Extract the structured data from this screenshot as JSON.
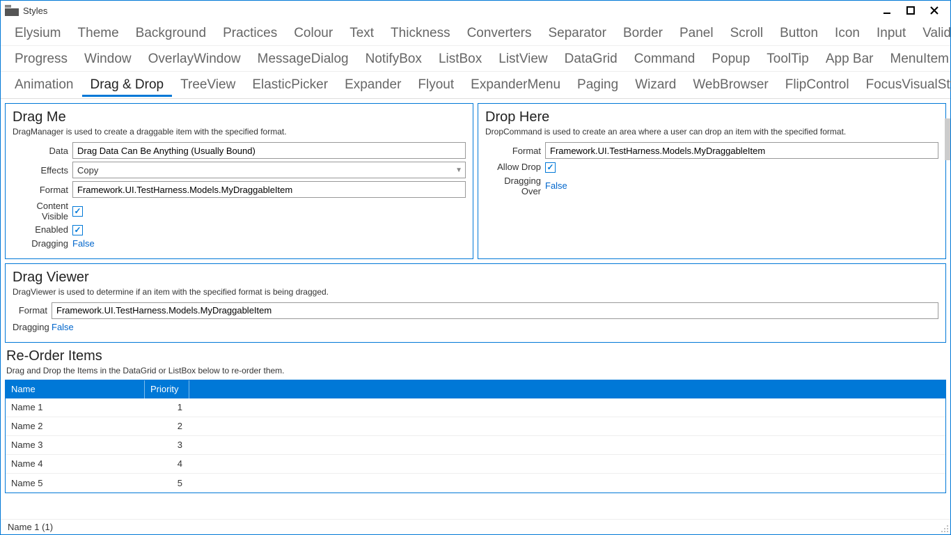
{
  "window": {
    "title": "Styles"
  },
  "tabs": {
    "row1": [
      "Elysium",
      "Theme",
      "Background",
      "Practices",
      "Colour",
      "Text",
      "Thickness",
      "Converters",
      "Separator",
      "Border",
      "Panel",
      "Scroll",
      "Button",
      "Icon",
      "Input",
      "Validation"
    ],
    "row2": [
      "Progress",
      "Window",
      "OverlayWindow",
      "MessageDialog",
      "NotifyBox",
      "ListBox",
      "ListView",
      "DataGrid",
      "Command",
      "Popup",
      "ToolTip",
      "App Bar",
      "MenuItem"
    ],
    "row3": [
      "Animation",
      "Drag & Drop",
      "TreeView",
      "ElasticPicker",
      "Expander",
      "Flyout",
      "ExpanderMenu",
      "Paging",
      "Wizard",
      "WebBrowser",
      "FlipControl",
      "FocusVisualStyle"
    ],
    "active": "Drag & Drop"
  },
  "dragMe": {
    "title": "Drag Me",
    "desc": "DragManager is used to create a draggable item with the specified format.",
    "labels": {
      "data": "Data",
      "effects": "Effects",
      "format": "Format",
      "contentVisible": "Content Visible",
      "enabled": "Enabled",
      "dragging": "Dragging"
    },
    "data": "Drag Data Can Be Anything (Usually Bound)",
    "effects": "Copy",
    "format": "Framework.UI.TestHarness.Models.MyDraggableItem",
    "contentVisible": true,
    "enabled": true,
    "dragging": "False"
  },
  "dropHere": {
    "title": "Drop Here",
    "desc": "DropCommand is used to create an area where a user can drop an item with the specified format.",
    "labels": {
      "format": "Format",
      "allowDrop": "Allow Drop",
      "draggingOver": "Dragging Over"
    },
    "format": "Framework.UI.TestHarness.Models.MyDraggableItem",
    "allowDrop": true,
    "draggingOver": "False"
  },
  "dragViewer": {
    "title": "Drag Viewer",
    "desc": "DragViewer is used to determine if an item with the specified format is being dragged.",
    "labels": {
      "format": "Format",
      "dragging": "Dragging"
    },
    "format": "Framework.UI.TestHarness.Models.MyDraggableItem",
    "dragging": "False"
  },
  "reorder": {
    "title": "Re-Order Items",
    "desc": "Drag and Drop the Items in the DataGrid or ListBox below to re-order them.",
    "columns": {
      "name": "Name",
      "priority": "Priority"
    },
    "rows": [
      {
        "name": "Name 1",
        "priority": "1"
      },
      {
        "name": "Name 2",
        "priority": "2"
      },
      {
        "name": "Name 3",
        "priority": "3"
      },
      {
        "name": "Name 4",
        "priority": "4"
      },
      {
        "name": "Name 5",
        "priority": "5"
      }
    ]
  },
  "status": "Name 1 (1)"
}
